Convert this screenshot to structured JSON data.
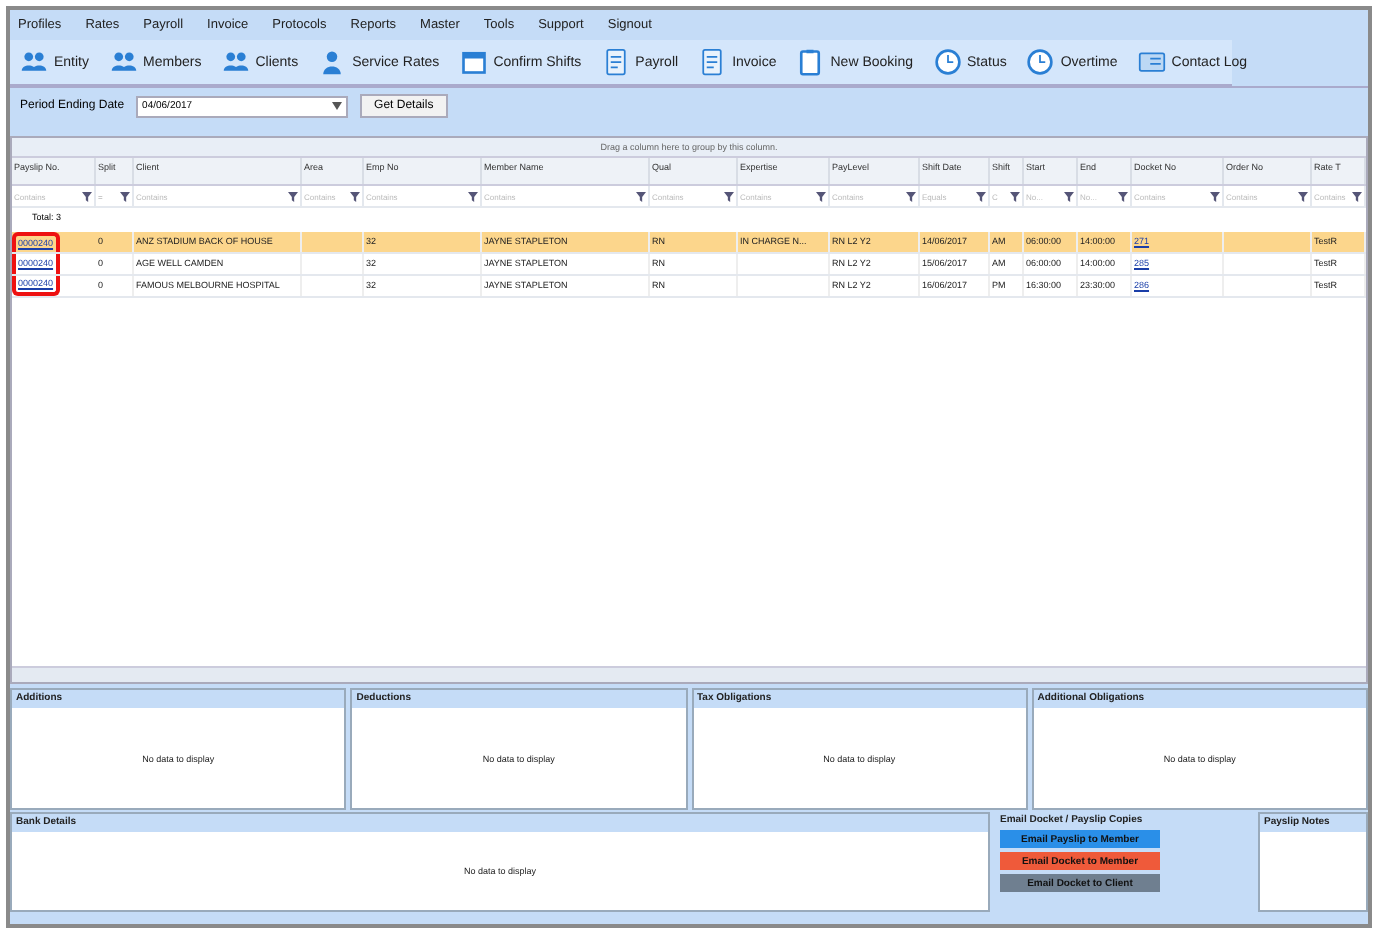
{
  "menu": [
    "Profiles",
    "Rates",
    "Payroll",
    "Invoice",
    "Protocols",
    "Reports",
    "Master",
    "Tools",
    "Support",
    "Signout"
  ],
  "toolbar": [
    "Entity",
    "Members",
    "Clients",
    "Service Rates",
    "Confirm Shifts",
    "Payroll",
    "Invoice",
    "New Booking",
    "Status",
    "Overtime",
    "Contact Log"
  ],
  "period": {
    "label": "Period Ending Date",
    "value": "04/06/2017",
    "button": "Get Details"
  },
  "grid": {
    "group_hint": "Drag a column here to group by this column.",
    "highlight_payslip_column": true,
    "columns": [
      {
        "label": "Payslip No.",
        "filter": "Contains"
      },
      {
        "label": "Split",
        "filter": "="
      },
      {
        "label": "Client",
        "filter": "Contains"
      },
      {
        "label": "Area",
        "filter": "Contains"
      },
      {
        "label": "Emp No",
        "filter": "Contains"
      },
      {
        "label": "Member Name",
        "filter": "Contains"
      },
      {
        "label": "Qual",
        "filter": "Contains"
      },
      {
        "label": "Expertise",
        "filter": "Contains"
      },
      {
        "label": "PayLevel",
        "filter": "Contains"
      },
      {
        "label": "Shift Date",
        "filter": "Equals"
      },
      {
        "label": "Shift",
        "filter": "C"
      },
      {
        "label": "Start",
        "filter": "No..."
      },
      {
        "label": "End",
        "filter": "No..."
      },
      {
        "label": "Docket No",
        "filter": "Contains"
      },
      {
        "label": "Order No",
        "filter": "Contains"
      },
      {
        "label": "Rate T",
        "filter": "Contains"
      }
    ],
    "total": "Total: 3",
    "rows": [
      {
        "selected": true,
        "cells": [
          "0000240",
          "0",
          "ANZ STADIUM BACK OF HOUSE",
          "",
          "32",
          "JAYNE STAPLETON",
          "RN",
          "IN CHARGE N...",
          "RN L2 Y2",
          "14/06/2017",
          "AM",
          "06:00:00",
          "14:00:00",
          "271",
          "",
          "TestR"
        ]
      },
      {
        "selected": false,
        "cells": [
          "0000240",
          "0",
          "AGE WELL CAMDEN",
          "",
          "32",
          "JAYNE STAPLETON",
          "RN",
          "",
          "RN L2 Y2",
          "15/06/2017",
          "AM",
          "06:00:00",
          "14:00:00",
          "285",
          "",
          "TestR"
        ]
      },
      {
        "selected": false,
        "cells": [
          "0000240",
          "0",
          "FAMOUS MELBOURNE HOSPITAL",
          "",
          "32",
          "JAYNE STAPLETON",
          "RN",
          "",
          "RN L2 Y2",
          "16/06/2017",
          "PM",
          "16:30:00",
          "23:30:00",
          "286",
          "",
          "TestR"
        ]
      }
    ]
  },
  "panels": [
    {
      "title": "Additions",
      "empty": "No data to display"
    },
    {
      "title": "Deductions",
      "empty": "No data to display"
    },
    {
      "title": "Tax Obligations",
      "empty": "No data to display"
    },
    {
      "title": "Additional Obligations",
      "empty": "No data to display"
    }
  ],
  "bank": {
    "title": "Bank Details",
    "empty": "No data to display"
  },
  "email": {
    "title": "Email Docket / Payslip Copies",
    "buttons": [
      {
        "label": "Email Payslip to Member",
        "color": "#2a8fe8"
      },
      {
        "label": "Email Docket to Member",
        "color": "#ef5a3a"
      },
      {
        "label": "Email Docket to Client",
        "color": "#6f7f90"
      }
    ]
  },
  "notes": {
    "title": "Payslip Notes"
  }
}
